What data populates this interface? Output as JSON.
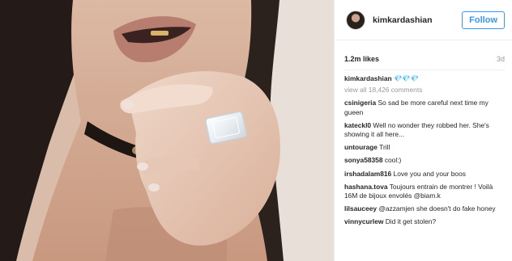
{
  "post": {
    "author": "kimkardashian",
    "follow_label": "Follow",
    "likes": "1.2m likes",
    "time_ago": "3d",
    "caption_user": "kimkardashian",
    "caption_text": "💎💎💎",
    "view_all": "view all 18,426 comments"
  },
  "comments": [
    {
      "user": "csinigeria",
      "text": "So sad be more careful next time my gueen"
    },
    {
      "user": "kateckl0",
      "text": "Well no wonder they robbed her. She's showing it all here..."
    },
    {
      "user": "untourage",
      "text": "Trill"
    },
    {
      "user": "sonya58358",
      "text": "cool:)"
    },
    {
      "user": "irshadalam816",
      "text": "Love you and your boos"
    },
    {
      "user": "hashana.tova",
      "text": "Toujours entrain de montrer ! Voilà 16M de bijoux envolés @biam.k"
    },
    {
      "user": "lilsauceey",
      "text": "@azzamjen she doesn't do fake honey"
    },
    {
      "user": "vinnycurlew",
      "text": "Did it get stolen?"
    }
  ],
  "colors": {
    "follow_blue": "#3897f0",
    "text": "#262626",
    "muted": "#999999"
  }
}
